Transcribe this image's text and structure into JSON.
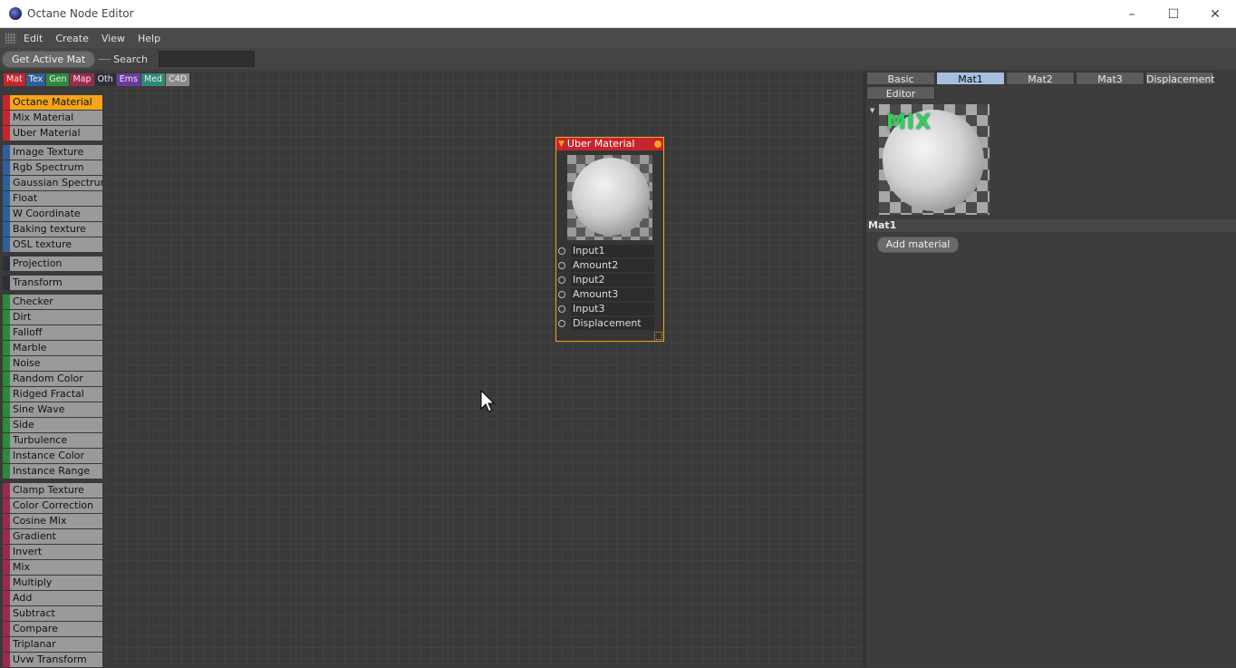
{
  "window": {
    "title": "Octane Node Editor",
    "controls": [
      "minimize",
      "maximize",
      "close"
    ]
  },
  "menu": [
    "Edit",
    "Create",
    "View",
    "Help"
  ],
  "toolbar": {
    "get_active_mat": "Get Active Mat",
    "search_label": "Search",
    "search_value": ""
  },
  "category_tabs": [
    {
      "label": "Mat",
      "color": "#c8242d"
    },
    {
      "label": "Tex",
      "color": "#2f5f9a"
    },
    {
      "label": "Gen",
      "color": "#2d8a3a"
    },
    {
      "label": "Map",
      "color": "#9a2b4c"
    },
    {
      "label": "Oth",
      "color": "#2b2f3a"
    },
    {
      "label": "Ems",
      "color": "#6a3aa0"
    },
    {
      "label": "Med",
      "color": "#2a8a7a"
    },
    {
      "label": "C4D",
      "color": "#8a8a8a"
    }
  ],
  "node_groups": [
    {
      "color": "#c8242d",
      "items": [
        "Octane Material",
        "Mix Material",
        "Uber Material"
      ]
    },
    {
      "color": "#2f5f9a",
      "items": [
        "Image Texture",
        "Rgb Spectrum",
        "Gaussian Spectrum",
        "Float",
        "W Coordinate",
        "Baking texture",
        "OSL texture"
      ]
    },
    {
      "color": "#2b2f3a",
      "items": [
        "Projection"
      ]
    },
    {
      "color": "#2b2f3a",
      "items": [
        "Transform"
      ]
    },
    {
      "color": "#2d8a3a",
      "items": [
        "Checker",
        "Dirt",
        "Falloff",
        "Marble",
        "Noise",
        "Random Color",
        "Ridged Fractal",
        "Sine Wave",
        "Side",
        "Turbulence",
        "Instance Color",
        "Instance Range"
      ]
    },
    {
      "color": "#9a2b4c",
      "items": [
        "Clamp Texture",
        "Color Correction",
        "Cosine Mix",
        "Gradient",
        "Invert",
        "Mix",
        "Multiply",
        "Add",
        "Subtract",
        "Compare",
        "Triplanar",
        "Uvw Transform"
      ]
    }
  ],
  "active_node_item": "Octane Material",
  "node": {
    "title": "Uber Material",
    "ports": [
      "Input1",
      "Amount2",
      "Input2",
      "Amount3",
      "Input3",
      "Displacement"
    ]
  },
  "right_panel": {
    "tabs": [
      "Basic",
      "Mat1",
      "Mat2",
      "Mat3",
      "Displacement",
      "Editor"
    ],
    "active_tab": "Mat1",
    "preview_text": "MIX",
    "section_title": "Mat1",
    "add_material": "Add material"
  }
}
